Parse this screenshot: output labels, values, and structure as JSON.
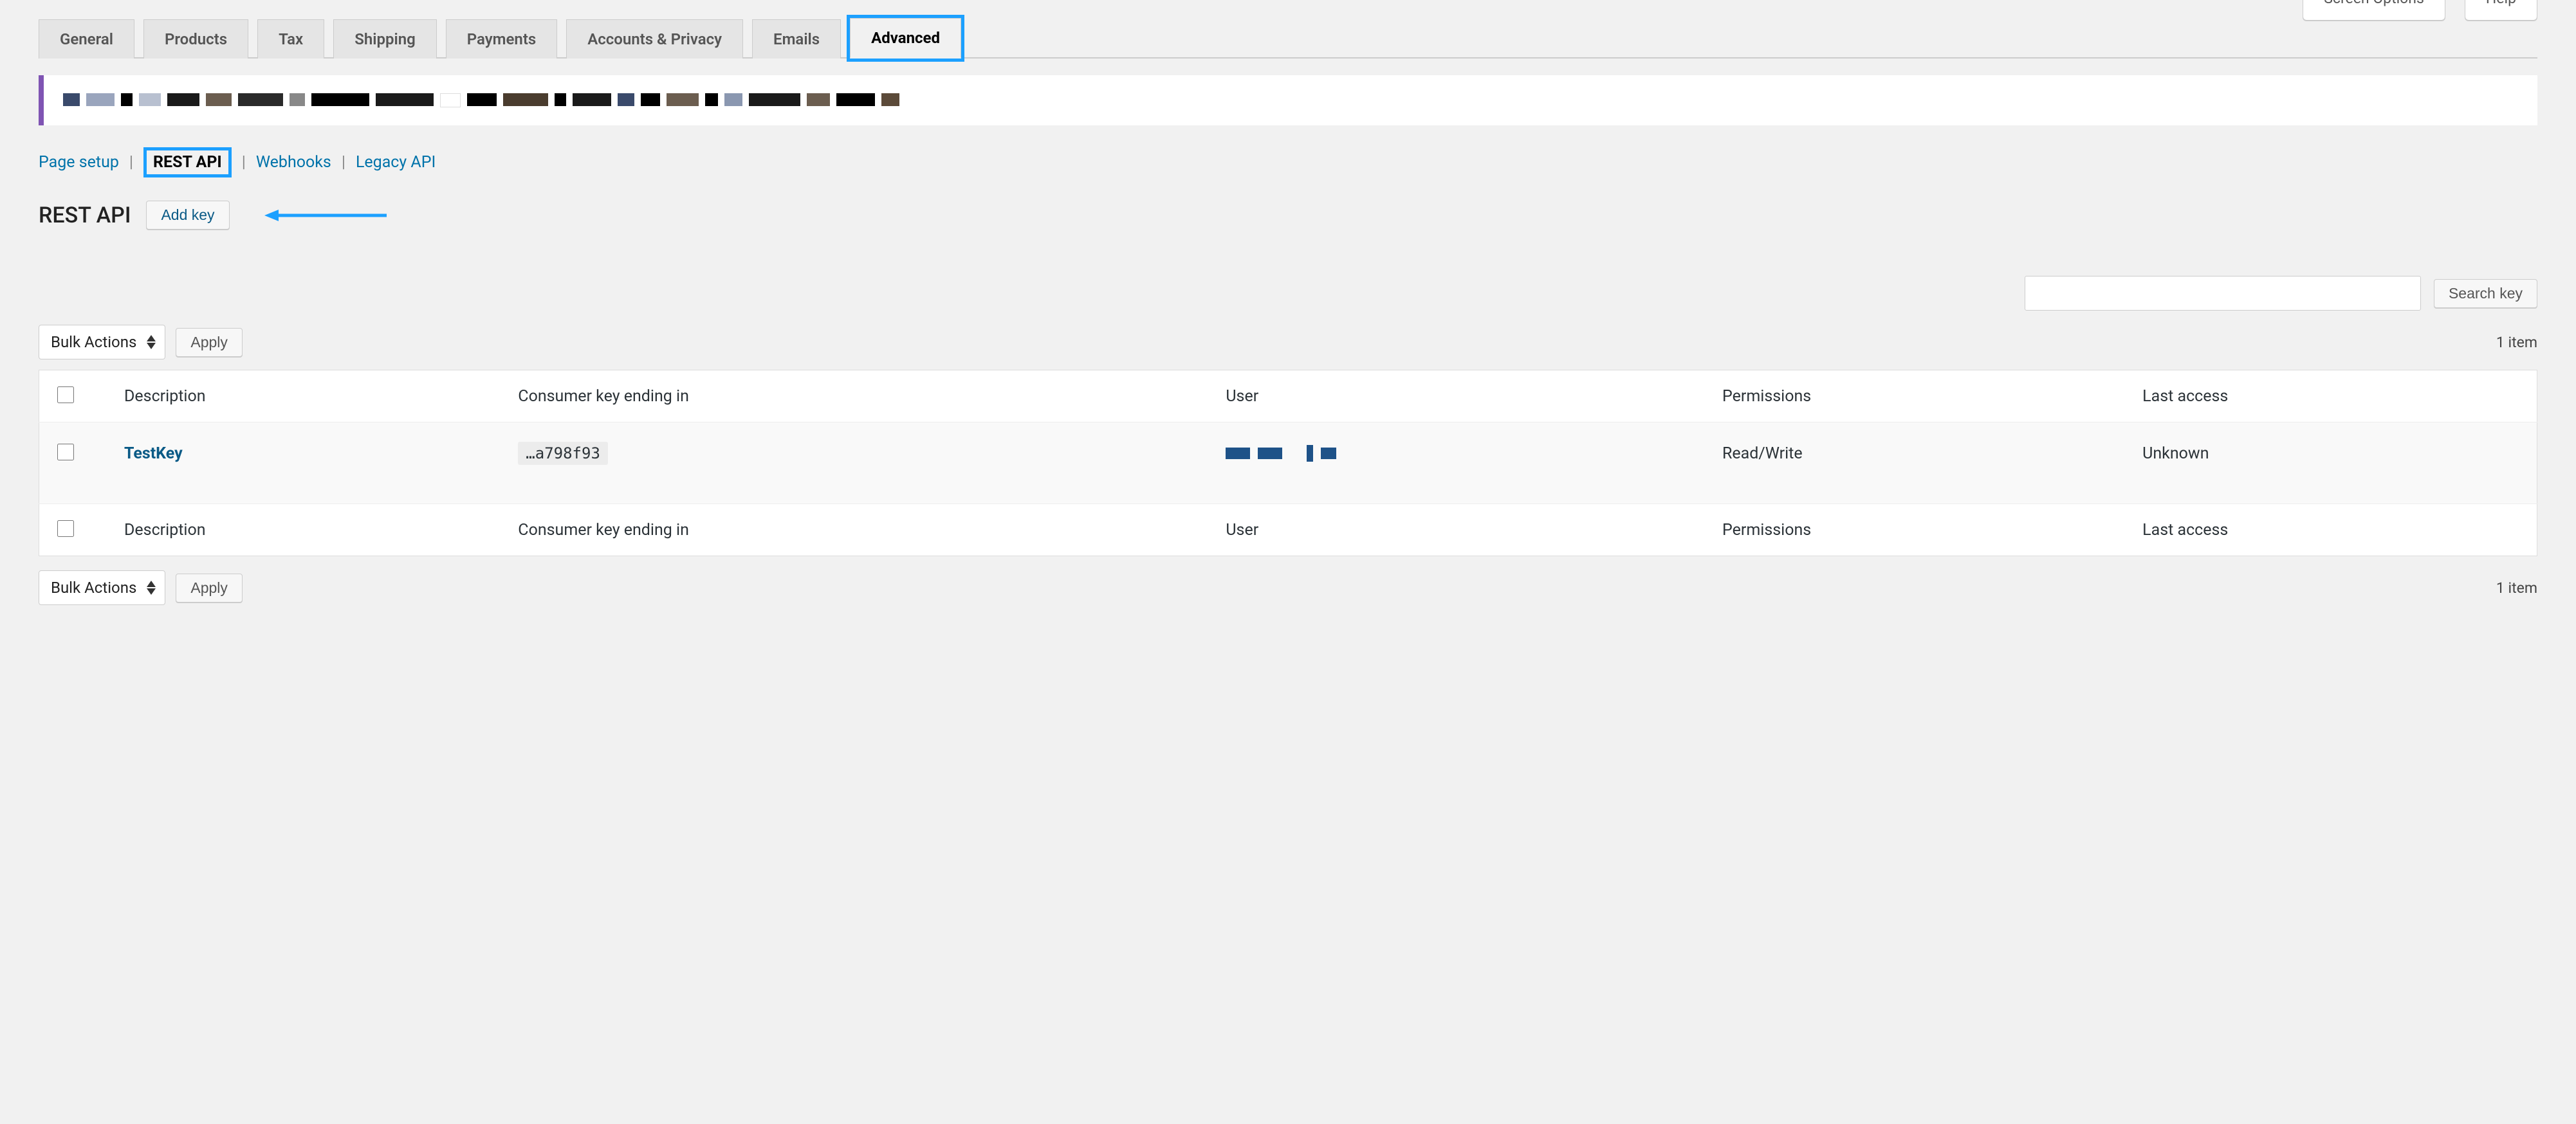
{
  "screenMeta": {
    "screenOptions": "Screen Options",
    "help": "Help"
  },
  "tabs": [
    {
      "id": "general",
      "label": "General",
      "active": false
    },
    {
      "id": "products",
      "label": "Products",
      "active": false
    },
    {
      "id": "tax",
      "label": "Tax",
      "active": false
    },
    {
      "id": "shipping",
      "label": "Shipping",
      "active": false
    },
    {
      "id": "payments",
      "label": "Payments",
      "active": false
    },
    {
      "id": "accounts",
      "label": "Accounts & Privacy",
      "active": false
    },
    {
      "id": "emails",
      "label": "Emails",
      "active": false
    },
    {
      "id": "advanced",
      "label": "Advanced",
      "active": true,
      "highlight": true
    }
  ],
  "subnav": {
    "pageSetup": "Page setup",
    "restApi": "REST API",
    "webhooks": "Webhooks",
    "legacyApi": "Legacy API"
  },
  "heading": "REST API",
  "addKey": "Add key",
  "search": {
    "placeholder": "",
    "button": "Search key"
  },
  "bulk": {
    "select": "Bulk Actions",
    "apply": "Apply"
  },
  "itemCount": "1 item",
  "columns": {
    "description": "Description",
    "consumerKey": "Consumer key ending in",
    "user": "User",
    "permissions": "Permissions",
    "lastAccess": "Last access"
  },
  "rows": [
    {
      "description": "TestKey",
      "consumerKey": "…a798f93",
      "user": "",
      "permissions": "Read/Write",
      "lastAccess": "Unknown"
    }
  ]
}
